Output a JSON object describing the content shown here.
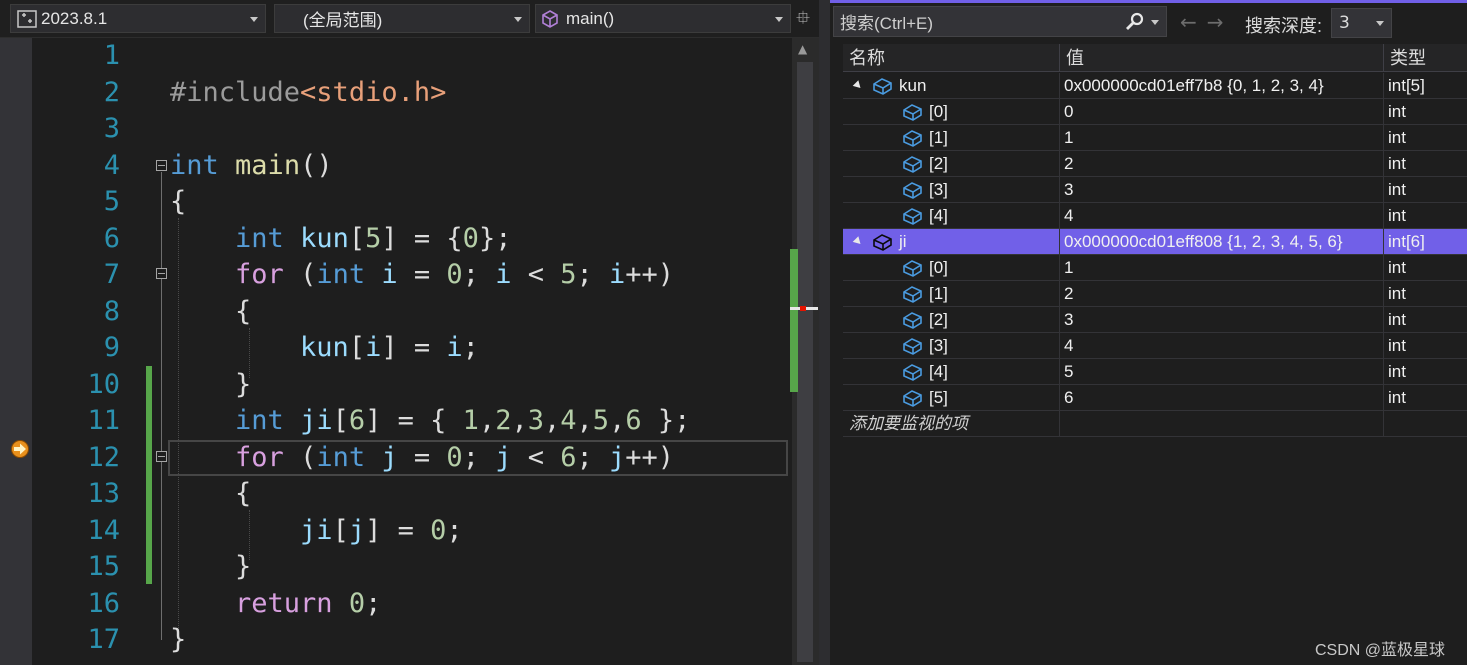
{
  "navbar": {
    "project": "2023.8.1",
    "scope": "(全局范围)",
    "function": "main()"
  },
  "line_numbers": [
    "1",
    "2",
    "3",
    "4",
    "5",
    "6",
    "7",
    "8",
    "9",
    "10",
    "11",
    "12",
    "13",
    "14",
    "15",
    "16",
    "17"
  ],
  "code_lines": [
    [],
    [
      {
        "t": "pre",
        "v": "#include"
      },
      {
        "t": "str",
        "v": "<stdio.h>"
      }
    ],
    [],
    [
      {
        "t": "kw",
        "v": "int"
      },
      {
        "t": "pn",
        "v": " "
      },
      {
        "t": "fn",
        "v": "main"
      },
      {
        "t": "pn",
        "v": "()"
      }
    ],
    [
      {
        "t": "pn",
        "v": "{"
      }
    ],
    [
      {
        "t": "pn",
        "v": "    "
      },
      {
        "t": "kw",
        "v": "int"
      },
      {
        "t": "pn",
        "v": " "
      },
      {
        "t": "var",
        "v": "kun"
      },
      {
        "t": "pn",
        "v": "["
      },
      {
        "t": "num",
        "v": "5"
      },
      {
        "t": "pn",
        "v": "] = {"
      },
      {
        "t": "num",
        "v": "0"
      },
      {
        "t": "pn",
        "v": "};"
      }
    ],
    [
      {
        "t": "pn",
        "v": "    "
      },
      {
        "t": "ctl",
        "v": "for"
      },
      {
        "t": "pn",
        "v": " ("
      },
      {
        "t": "kw",
        "v": "int"
      },
      {
        "t": "pn",
        "v": " "
      },
      {
        "t": "var",
        "v": "i"
      },
      {
        "t": "pn",
        "v": " = "
      },
      {
        "t": "num",
        "v": "0"
      },
      {
        "t": "pn",
        "v": "; "
      },
      {
        "t": "var",
        "v": "i"
      },
      {
        "t": "pn",
        "v": " < "
      },
      {
        "t": "num",
        "v": "5"
      },
      {
        "t": "pn",
        "v": "; "
      },
      {
        "t": "var",
        "v": "i"
      },
      {
        "t": "pn",
        "v": "++)"
      }
    ],
    [
      {
        "t": "pn",
        "v": "    {"
      }
    ],
    [
      {
        "t": "pn",
        "v": "        "
      },
      {
        "t": "var",
        "v": "kun"
      },
      {
        "t": "pn",
        "v": "["
      },
      {
        "t": "var",
        "v": "i"
      },
      {
        "t": "pn",
        "v": "] = "
      },
      {
        "t": "var",
        "v": "i"
      },
      {
        "t": "pn",
        "v": ";"
      }
    ],
    [
      {
        "t": "pn",
        "v": "    }"
      }
    ],
    [
      {
        "t": "pn",
        "v": "    "
      },
      {
        "t": "kw",
        "v": "int"
      },
      {
        "t": "pn",
        "v": " "
      },
      {
        "t": "var",
        "v": "ji"
      },
      {
        "t": "pn",
        "v": "["
      },
      {
        "t": "num",
        "v": "6"
      },
      {
        "t": "pn",
        "v": "] = { "
      },
      {
        "t": "num",
        "v": "1"
      },
      {
        "t": "pn",
        "v": ","
      },
      {
        "t": "num",
        "v": "2"
      },
      {
        "t": "pn",
        "v": ","
      },
      {
        "t": "num",
        "v": "3"
      },
      {
        "t": "pn",
        "v": ","
      },
      {
        "t": "num",
        "v": "4"
      },
      {
        "t": "pn",
        "v": ","
      },
      {
        "t": "num",
        "v": "5"
      },
      {
        "t": "pn",
        "v": ","
      },
      {
        "t": "num",
        "v": "6"
      },
      {
        "t": "pn",
        "v": " };"
      }
    ],
    [
      {
        "t": "pn",
        "v": "    "
      },
      {
        "t": "ctl",
        "v": "for"
      },
      {
        "t": "pn",
        "v": " ("
      },
      {
        "t": "kw",
        "v": "int"
      },
      {
        "t": "pn",
        "v": " "
      },
      {
        "t": "var",
        "v": "j"
      },
      {
        "t": "pn",
        "v": " = "
      },
      {
        "t": "num",
        "v": "0"
      },
      {
        "t": "pn",
        "v": "; "
      },
      {
        "t": "var",
        "v": "j"
      },
      {
        "t": "pn",
        "v": " < "
      },
      {
        "t": "num",
        "v": "6"
      },
      {
        "t": "pn",
        "v": "; "
      },
      {
        "t": "var",
        "v": "j"
      },
      {
        "t": "pn",
        "v": "++)"
      }
    ],
    [
      {
        "t": "pn",
        "v": "    {"
      }
    ],
    [
      {
        "t": "pn",
        "v": "        "
      },
      {
        "t": "var",
        "v": "ji"
      },
      {
        "t": "pn",
        "v": "["
      },
      {
        "t": "var",
        "v": "j"
      },
      {
        "t": "pn",
        "v": "] = "
      },
      {
        "t": "num",
        "v": "0"
      },
      {
        "t": "pn",
        "v": ";"
      }
    ],
    [
      {
        "t": "pn",
        "v": "    }"
      }
    ],
    [
      {
        "t": "pn",
        "v": "    "
      },
      {
        "t": "ctl",
        "v": "return"
      },
      {
        "t": "pn",
        "v": " "
      },
      {
        "t": "num",
        "v": "0"
      },
      {
        "t": "pn",
        "v": ";"
      }
    ],
    [
      {
        "t": "pn",
        "v": "}"
      }
    ]
  ],
  "current_line": "12",
  "watch": {
    "search_placeholder": "搜索(Ctrl+E)",
    "search_depth_label": "搜索深度:",
    "search_depth_value": "3",
    "columns": {
      "name": "名称",
      "value": "值",
      "type": "类型"
    },
    "rows": [
      {
        "name": "kun",
        "value": "0x000000cd01eff7b8 {0, 1, 2, 3, 4}",
        "type": "int[5]",
        "level": 0,
        "expanded": true,
        "selected": false
      },
      {
        "name": "[0]",
        "value": "0",
        "type": "int",
        "level": 1
      },
      {
        "name": "[1]",
        "value": "1",
        "type": "int",
        "level": 1
      },
      {
        "name": "[2]",
        "value": "2",
        "type": "int",
        "level": 1
      },
      {
        "name": "[3]",
        "value": "3",
        "type": "int",
        "level": 1
      },
      {
        "name": "[4]",
        "value": "4",
        "type": "int",
        "level": 1
      },
      {
        "name": "ji",
        "value": "0x000000cd01eff808 {1, 2, 3, 4, 5, 6}",
        "type": "int[6]",
        "level": 0,
        "expanded": true,
        "selected": true
      },
      {
        "name": "[0]",
        "value": "1",
        "type": "int",
        "level": 1
      },
      {
        "name": "[1]",
        "value": "2",
        "type": "int",
        "level": 1
      },
      {
        "name": "[2]",
        "value": "3",
        "type": "int",
        "level": 1
      },
      {
        "name": "[3]",
        "value": "4",
        "type": "int",
        "level": 1
      },
      {
        "name": "[4]",
        "value": "5",
        "type": "int",
        "level": 1
      },
      {
        "name": "[5]",
        "value": "6",
        "type": "int",
        "level": 1
      }
    ],
    "add_item": "添加要监视的项"
  },
  "watermark": "CSDN @蓝极星球",
  "colors": {
    "accent": "#7160e8",
    "changed_bar": "#57a64a",
    "line_number": "#2b91af"
  }
}
